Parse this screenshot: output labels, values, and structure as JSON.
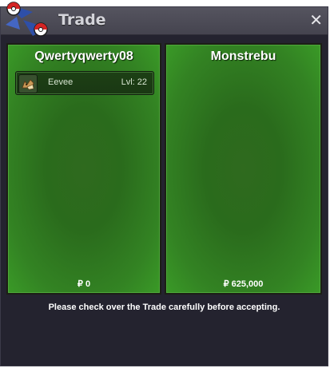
{
  "window": {
    "title": "Trade",
    "close_label": "✕",
    "notice": "Please check over the Trade carefully before accepting."
  },
  "left_panel": {
    "player_name": "Qwertyqwerty08",
    "items": [
      {
        "name": "Eevee",
        "level": "Lvl: 22",
        "icon": "eevee-icon"
      }
    ],
    "money": "₽ 0"
  },
  "right_panel": {
    "player_name": "Monstrebu",
    "items": [],
    "money": "₽ 625,000"
  },
  "colors": {
    "panel_green": "#2f7a1f",
    "window_bg": "#24232f",
    "titlebar": "#4d4c57"
  }
}
